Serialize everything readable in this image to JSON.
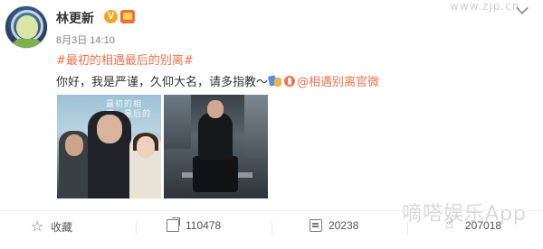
{
  "post": {
    "username": "林更新",
    "verified_badge": "V",
    "timestamp": "8月3日 14:10",
    "hashtag": "#最初的相遇最后的别离#",
    "content_text": "你好，我是严谨，久仰大名，请多指教～",
    "mention": "@相遇别离官微",
    "image1_title": "最初的相遇，最后的别离",
    "top_watermark": "www.zjp.cn"
  },
  "actions": {
    "favorite_label": "收藏",
    "share_count": "110478",
    "comment_count": "20238",
    "like_count": "207018"
  },
  "watermark": "嘀嗒娱乐App",
  "icons": {
    "favorite": "star-icon",
    "share": "share-icon",
    "comment": "comment-icon",
    "like": "thumbs-up-icon",
    "more": "chevron-down-icon"
  },
  "colors": {
    "accent": "#eb7350",
    "text": "#333333",
    "muted": "#808080"
  }
}
